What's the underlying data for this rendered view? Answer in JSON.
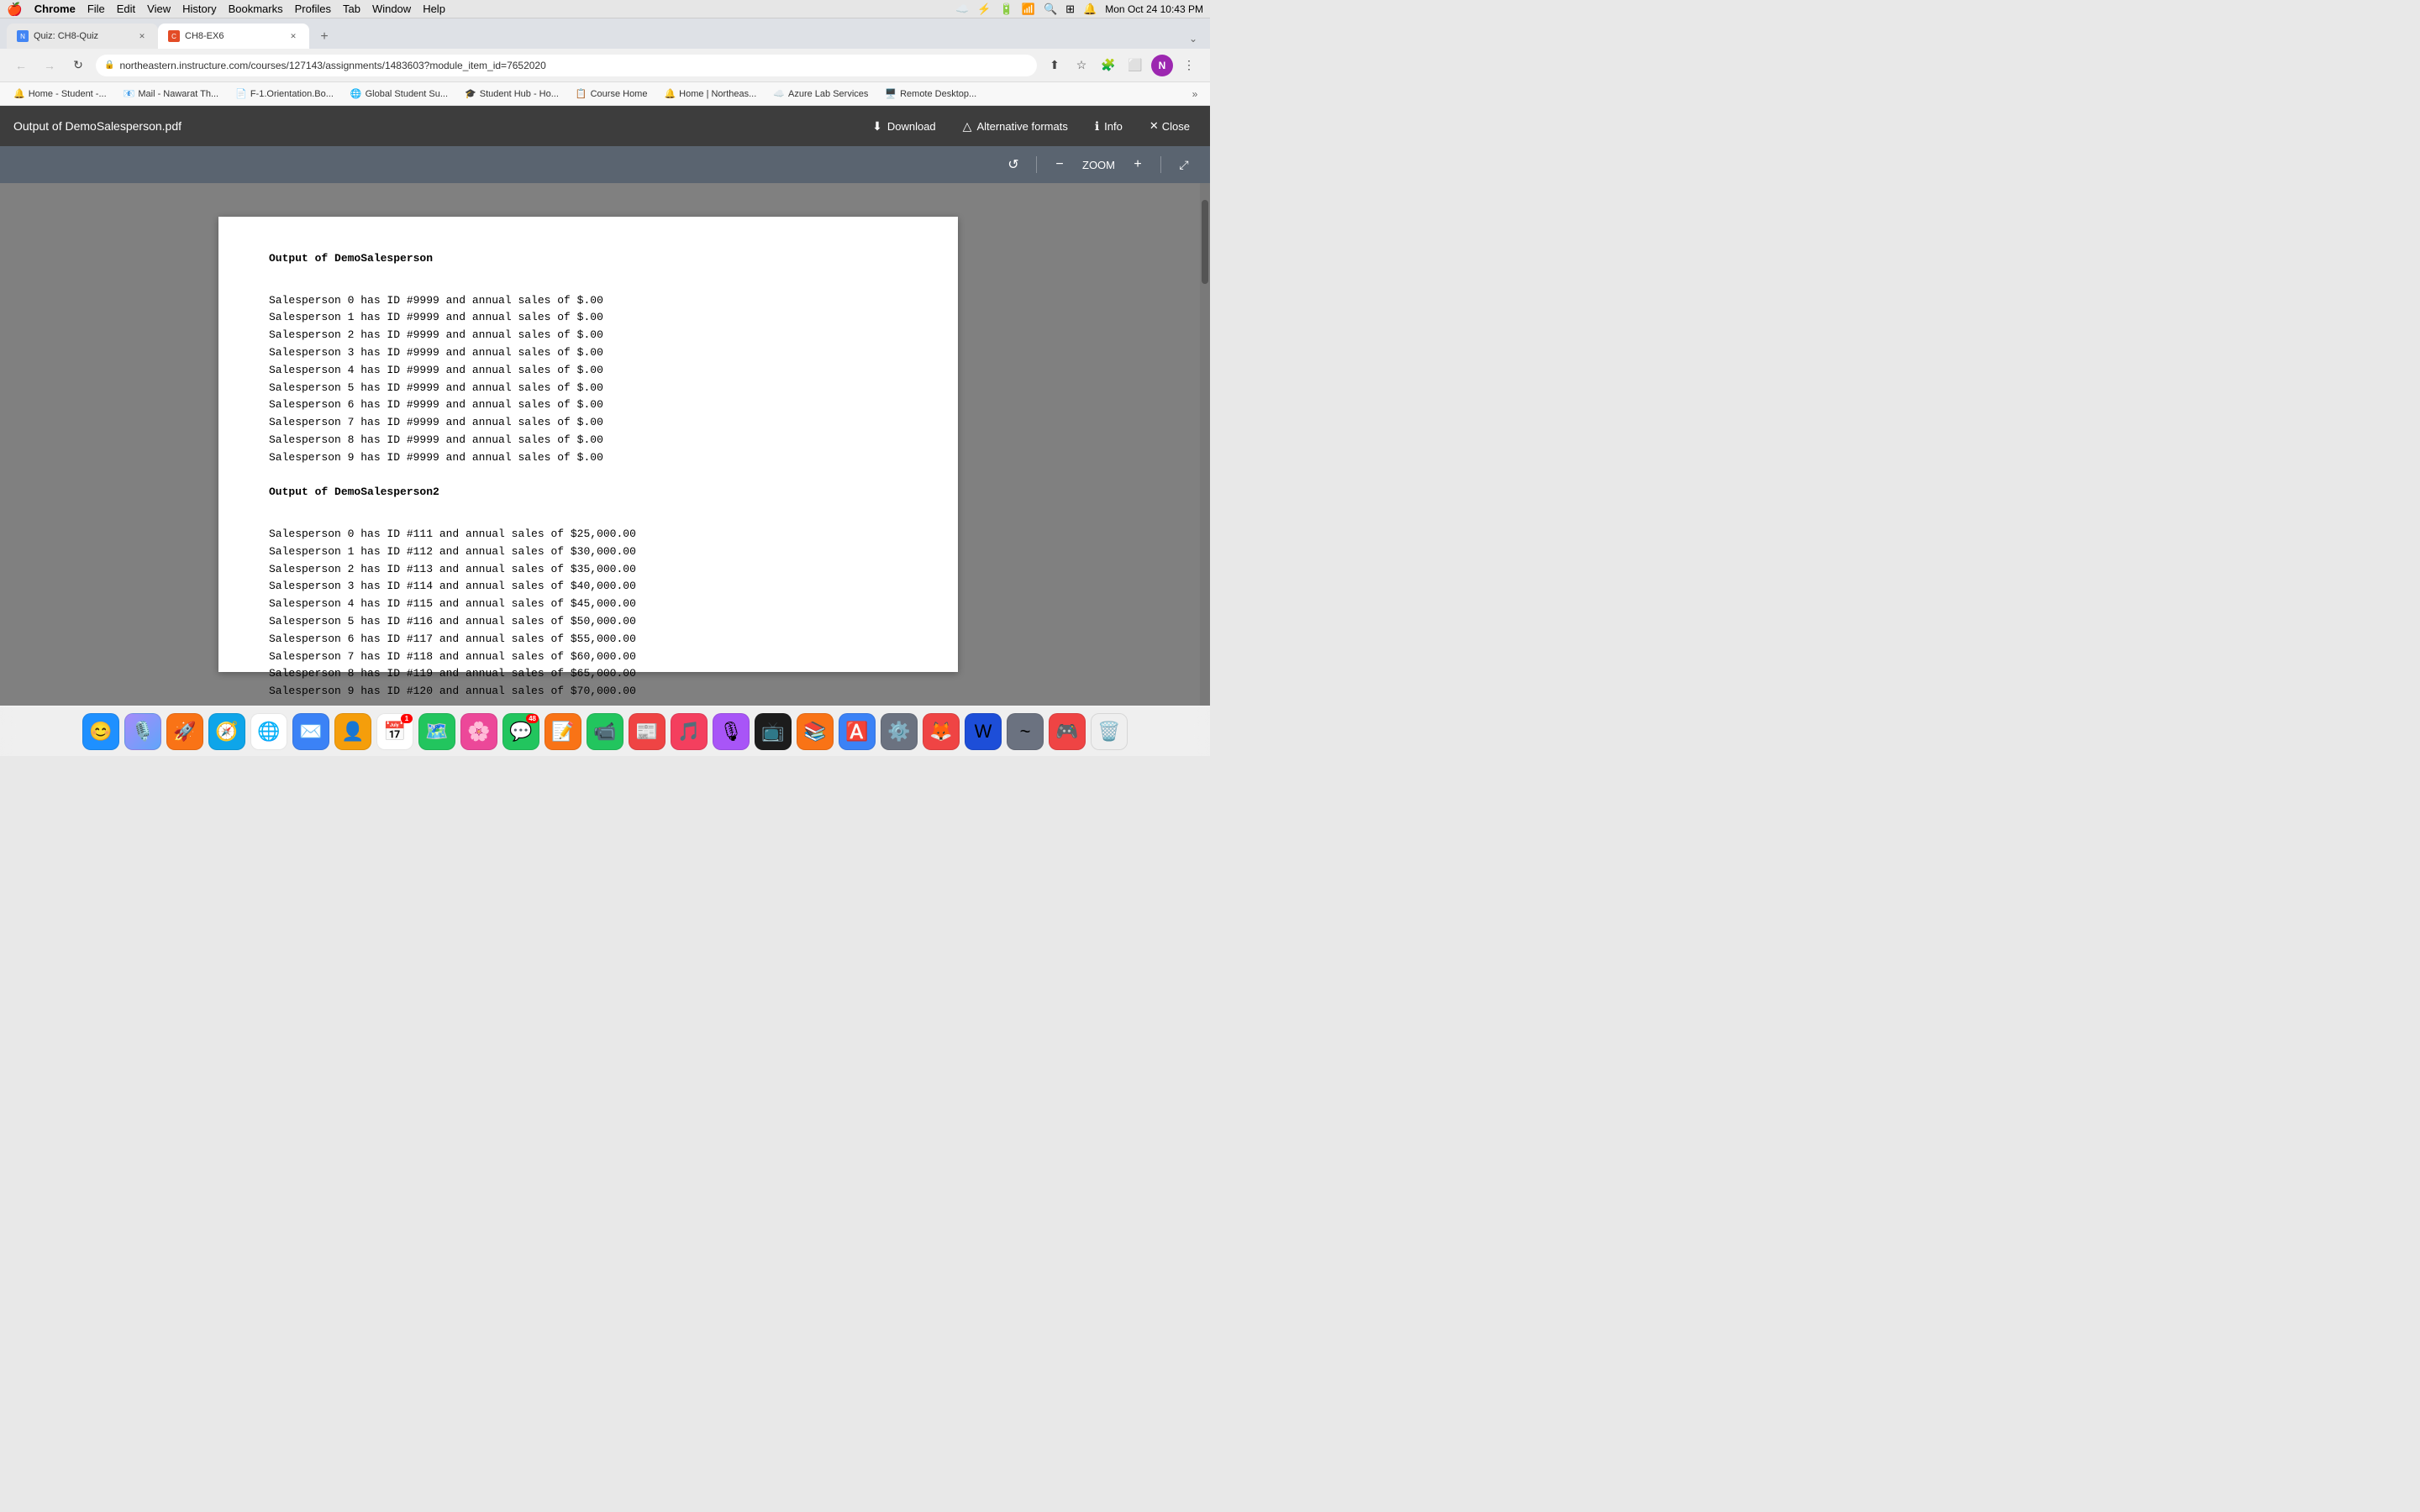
{
  "menubar": {
    "apple": "🍎",
    "items": [
      "Chrome",
      "File",
      "Edit",
      "View",
      "History",
      "Bookmarks",
      "Profiles",
      "Tab",
      "Window",
      "Help"
    ],
    "chrome_bold": true,
    "right": {
      "datetime": "Mon Oct 24  10:43 PM"
    }
  },
  "tabs": [
    {
      "id": "tab1",
      "title": "Quiz: CH8-Quiz",
      "icon_color": "#4285f4",
      "active": false,
      "closeable": true
    },
    {
      "id": "tab2",
      "title": "CH8-EX6",
      "icon_color": "#e34c26",
      "active": true,
      "closeable": true
    }
  ],
  "addressbar": {
    "url": "northeastern.instructure.com/courses/127143/assignments/1483603?module_item_id=7652020",
    "url_display": "northeastern.instructure.com/courses/127143/assignments/1483603?module_item_id=7652020"
  },
  "bookmarks": [
    {
      "id": "bm1",
      "label": "Home - Student -...",
      "icon": "🔔"
    },
    {
      "id": "bm2",
      "label": "Mail - Nawarat Th...",
      "icon": "📧"
    },
    {
      "id": "bm3",
      "label": "F-1.Orientation.Bo...",
      "icon": "📄"
    },
    {
      "id": "bm4",
      "label": "Global Student Su...",
      "icon": "🌐"
    },
    {
      "id": "bm5",
      "label": "Student Hub - Ho...",
      "icon": "🎓"
    },
    {
      "id": "bm6",
      "label": "Course Home",
      "icon": "📋"
    },
    {
      "id": "bm7",
      "label": "Home | Northeas...",
      "icon": "🔔"
    },
    {
      "id": "bm8",
      "label": "Azure Lab Services",
      "icon": "☁️"
    },
    {
      "id": "bm9",
      "label": "Remote Desktop...",
      "icon": "🖥️"
    }
  ],
  "pdf_header": {
    "title": "Output of DemoSalesperson.pdf",
    "download_label": "Download",
    "alt_formats_label": "Alternative formats",
    "info_label": "Info",
    "close_label": "Close"
  },
  "pdf_toolbar": {
    "zoom_label": "ZOOM"
  },
  "pdf_content": {
    "section1_title": "Output of DemoSalesperson",
    "section1_lines": [
      "Salesperson 0 has ID #9999 and annual sales of $.00",
      "Salesperson 1 has ID #9999 and annual sales of $.00",
      "Salesperson 2 has ID #9999 and annual sales of $.00",
      "Salesperson 3 has ID #9999 and annual sales of $.00",
      "Salesperson 4 has ID #9999 and annual sales of $.00",
      "Salesperson 5 has ID #9999 and annual sales of $.00",
      "Salesperson 6 has ID #9999 and annual sales of $.00",
      "Salesperson 7 has ID #9999 and annual sales of $.00",
      "Salesperson 8 has ID #9999 and annual sales of $.00",
      "Salesperson 9 has ID #9999 and annual sales of $.00"
    ],
    "section2_title": "Output of DemoSalesperson2",
    "section2_lines": [
      "Salesperson 0 has ID #111 and annual sales of $25,000.00",
      "Salesperson 1 has ID #112 and annual sales of $30,000.00",
      "Salesperson 2 has ID #113 and annual sales of $35,000.00",
      "Salesperson 3 has ID #114 and annual sales of $40,000.00",
      "Salesperson 4 has ID #115 and annual sales of $45,000.00",
      "Salesperson 5 has ID #116 and annual sales of $50,000.00",
      "Salesperson 6 has ID #117 and annual sales of $55,000.00",
      "Salesperson 7 has ID #118 and annual sales of $60,000.00",
      "Salesperson 8 has ID #119 and annual sales of $65,000.00",
      "Salesperson 9 has ID #120 and annual sales of $70,000.00"
    ]
  },
  "dock": {
    "items": [
      {
        "id": "finder",
        "emoji": "😊",
        "bg": "#1e90ff",
        "label": "Finder"
      },
      {
        "id": "siri",
        "emoji": "🎙️",
        "bg": "linear-gradient(135deg,#a78bfa,#60a5fa)",
        "label": "Siri"
      },
      {
        "id": "launchpad",
        "emoji": "🚀",
        "bg": "#f97316",
        "label": "Launchpad"
      },
      {
        "id": "safari",
        "emoji": "🧭",
        "bg": "#0ea5e9",
        "label": "Safari"
      },
      {
        "id": "chrome",
        "emoji": "🌐",
        "bg": "white",
        "label": "Chrome"
      },
      {
        "id": "mail",
        "emoji": "✉️",
        "bg": "#3b82f6",
        "label": "Mail"
      },
      {
        "id": "contacts",
        "emoji": "👤",
        "bg": "#f59e0b",
        "label": "Contacts"
      },
      {
        "id": "calendar",
        "emoji": "📅",
        "bg": "white",
        "label": "Calendar",
        "badge": "1"
      },
      {
        "id": "maps",
        "emoji": "🗺️",
        "bg": "#22c55e",
        "label": "Maps"
      },
      {
        "id": "photos",
        "emoji": "🌸",
        "bg": "#ec4899",
        "label": "Photos"
      },
      {
        "id": "messages",
        "emoji": "💬",
        "bg": "#22c55e",
        "label": "Messages",
        "badge": "48"
      },
      {
        "id": "pages",
        "emoji": "📝",
        "bg": "#f97316",
        "label": "Pages"
      },
      {
        "id": "facetime",
        "emoji": "📹",
        "bg": "#22c55e",
        "label": "FaceTime"
      },
      {
        "id": "news",
        "emoji": "📰",
        "bg": "#ef4444",
        "label": "News"
      },
      {
        "id": "music",
        "emoji": "🎵",
        "bg": "#f43f5e",
        "label": "Music"
      },
      {
        "id": "podcasts",
        "emoji": "🎙",
        "bg": "#a855f7",
        "label": "Podcasts"
      },
      {
        "id": "appletv",
        "emoji": "📺",
        "bg": "#1c1c1c",
        "label": "Apple TV"
      },
      {
        "id": "books",
        "emoji": "📚",
        "bg": "#f97316",
        "label": "Books"
      },
      {
        "id": "appstore",
        "emoji": "🅰️",
        "bg": "#3b82f6",
        "label": "App Store"
      },
      {
        "id": "systemprefs",
        "emoji": "⚙️",
        "bg": "#6b7280",
        "label": "System Preferences"
      },
      {
        "id": "addon1",
        "emoji": "🦊",
        "bg": "#ef4444",
        "label": "App 1"
      },
      {
        "id": "word",
        "emoji": "W",
        "bg": "#1d4ed8",
        "label": "Word"
      },
      {
        "id": "app2",
        "emoji": "~",
        "bg": "#6b7280",
        "label": "App 2"
      },
      {
        "id": "app3",
        "emoji": "🎮",
        "bg": "#ef4444",
        "label": "App 3"
      },
      {
        "id": "trash",
        "emoji": "🗑️",
        "bg": "transparent",
        "label": "Trash"
      }
    ]
  }
}
